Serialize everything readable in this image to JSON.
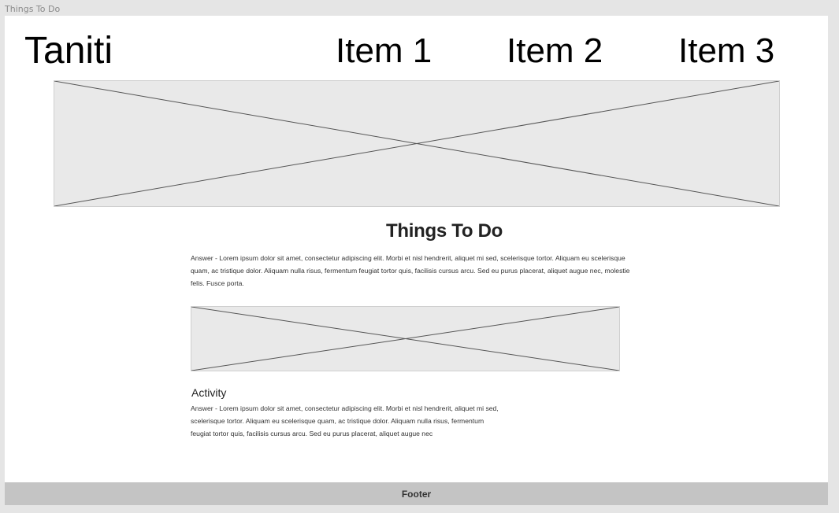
{
  "frame": {
    "label": "Things To Do"
  },
  "header": {
    "brand": "Taniti",
    "nav": [
      {
        "label": "Item 1"
      },
      {
        "label": "Item 2"
      },
      {
        "label": "Item 3"
      }
    ]
  },
  "main": {
    "title": "Things To Do",
    "intro": "Answer - Lorem ipsum dolor sit amet, consectetur adipiscing elit. Morbi et nisl hendrerit, aliquet mi sed, scelerisque tortor. Aliquam eu scelerisque quam, ac tristique dolor. Aliquam nulla risus, fermentum feugiat tortor quis, facilisis cursus arcu. Sed eu purus placerat, aliquet augue nec, molestie felis. Fusce porta.",
    "activity": {
      "title": "Activity",
      "text": "Answer - Lorem ipsum dolor sit amet, consectetur adipiscing elit. Morbi et nisl hendrerit, aliquet mi sed, scelerisque tortor. Aliquam eu scelerisque quam, ac tristique dolor. Aliquam nulla risus, fermentum feugiat tortor quis, facilisis cursus arcu. Sed eu purus placerat, aliquet augue nec"
    }
  },
  "footer": {
    "label": "Footer"
  },
  "colors": {
    "canvas": "#e5e5e5",
    "frame": "#ffffff",
    "placeholder": "#e9e9e9",
    "footer": "#c4c4c4"
  }
}
